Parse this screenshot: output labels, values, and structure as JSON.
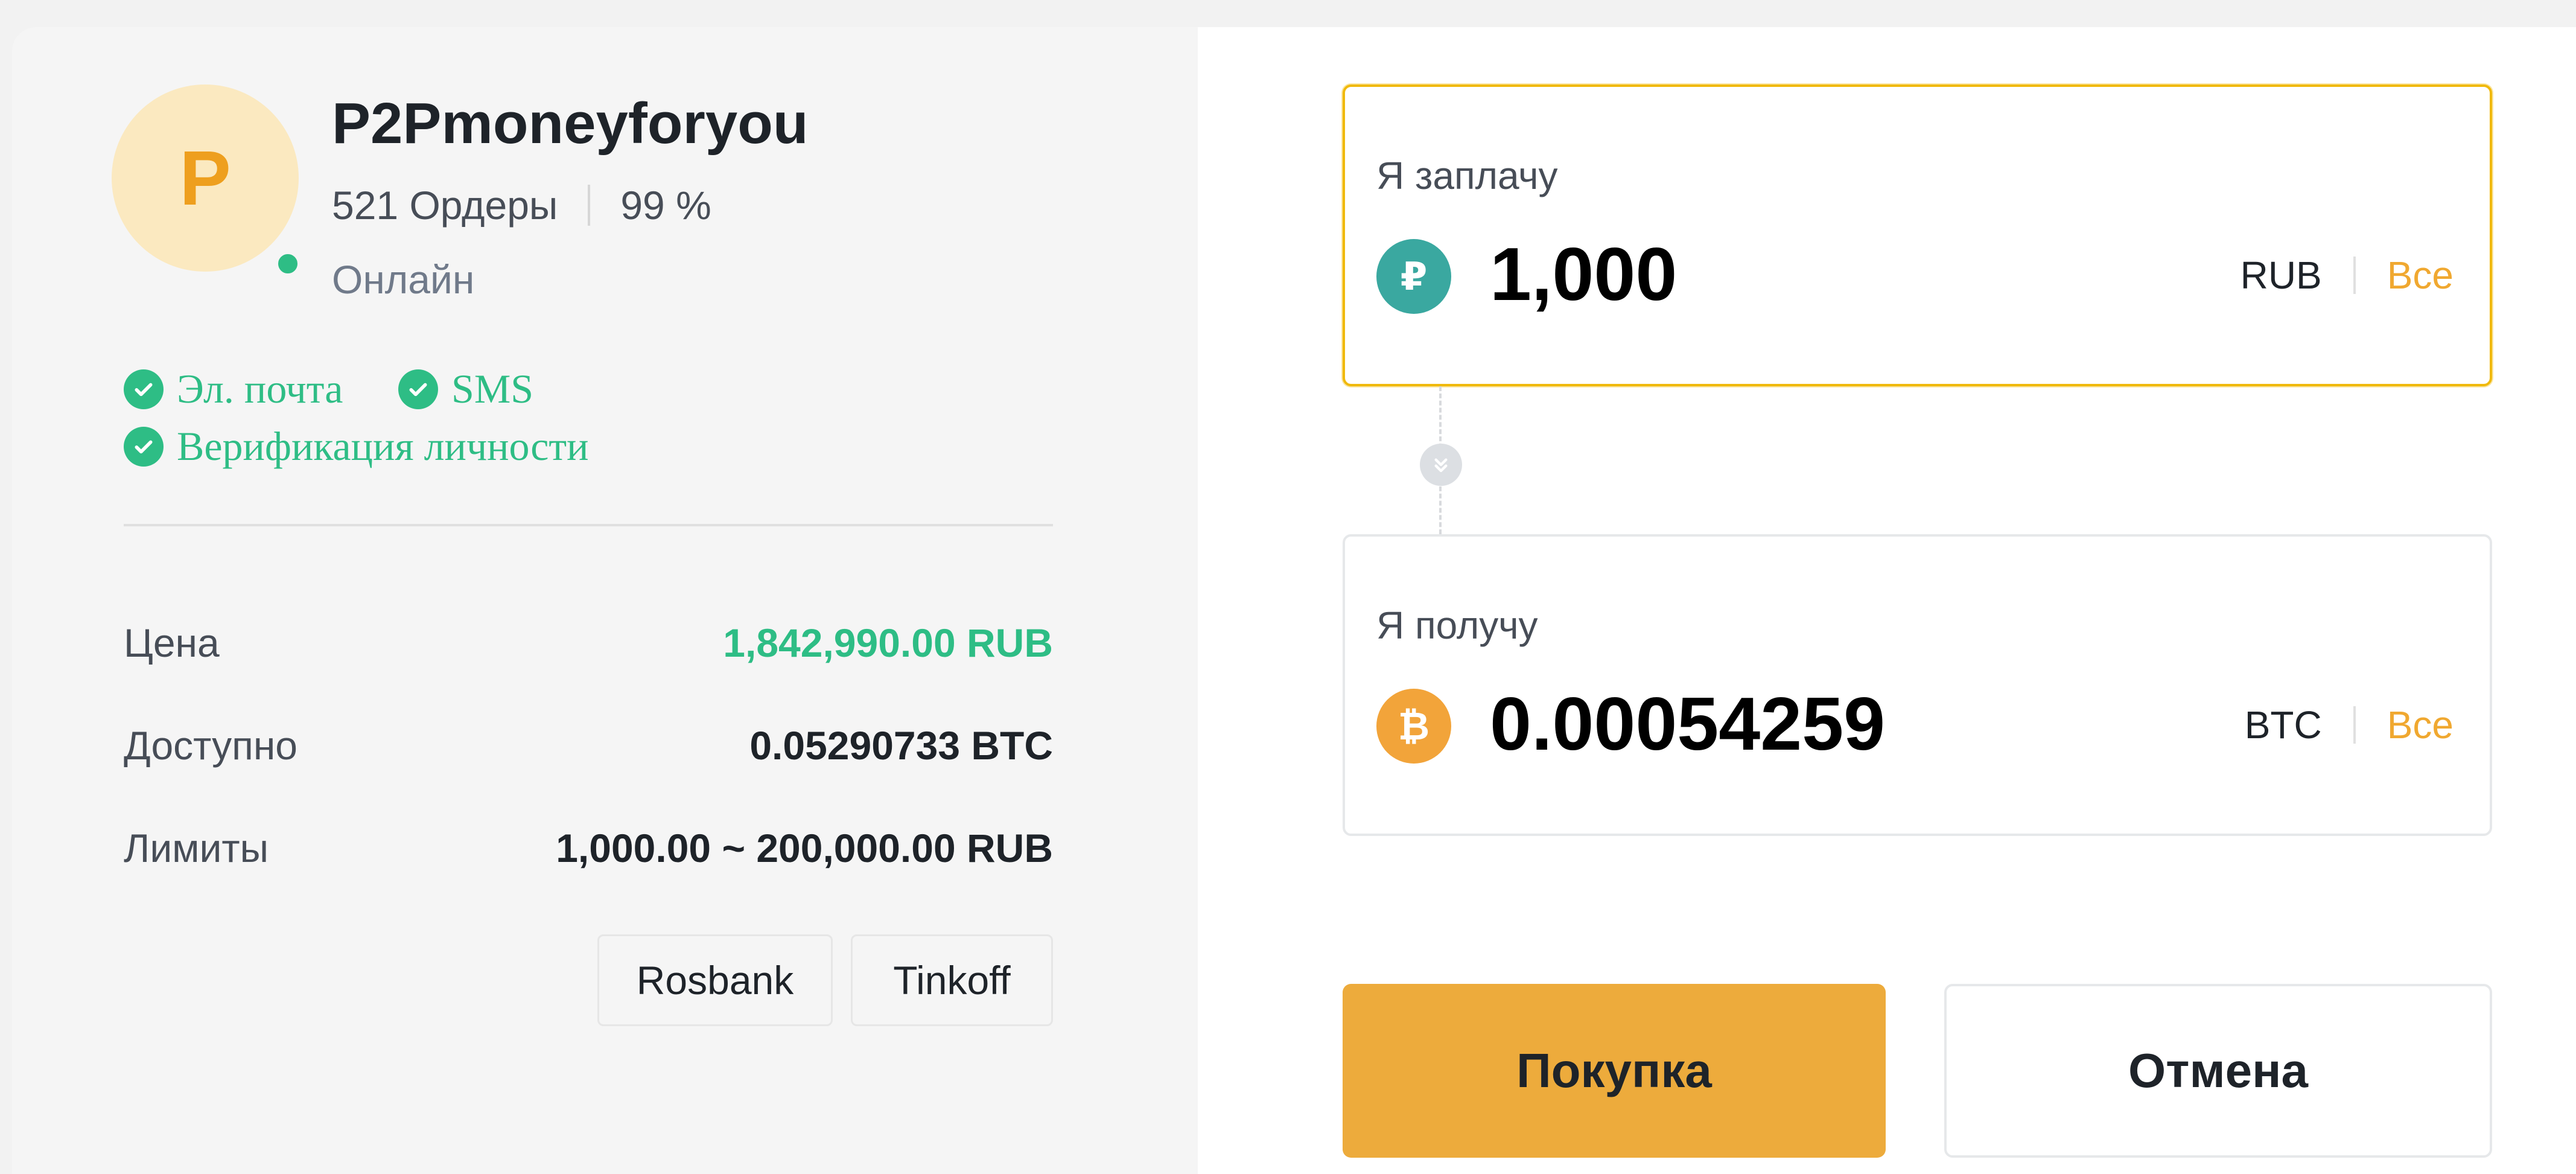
{
  "merchant": {
    "avatar_letter": "P",
    "name": "P2Pmoneyforyou",
    "orders": "521 Ордеры",
    "completion": "99 %",
    "status": "Онлайн",
    "verifications": {
      "email": "Эл. почта",
      "sms": "SMS",
      "identity": "Верификация личности"
    }
  },
  "offer": {
    "price_label": "Цена",
    "price_value": "1,842,990.00 RUB",
    "available_label": "Доступно",
    "available_value": "0.05290733 BTC",
    "limits_label": "Лимиты",
    "limits_value": "1,000.00 ~ 200,000.00 RUB",
    "payment_methods": [
      "Rosbank",
      "Tinkoff"
    ]
  },
  "pay": {
    "label": "Я заплачу",
    "icon_glyph": "₽",
    "icon": "ruble-coin-icon",
    "amount": "1,000",
    "currency": "RUB",
    "all_label": "Все"
  },
  "receive": {
    "label": "Я получу",
    "icon_glyph": "₿",
    "icon": "bitcoin-coin-icon",
    "amount": "0.00054259",
    "currency": "BTC",
    "all_label": "Все"
  },
  "actions": {
    "buy_label": "Покупка",
    "cancel_label": "Отмена"
  },
  "colors": {
    "accent": "#edab3c",
    "positive": "#2ebd85",
    "link": "#f0a830"
  }
}
